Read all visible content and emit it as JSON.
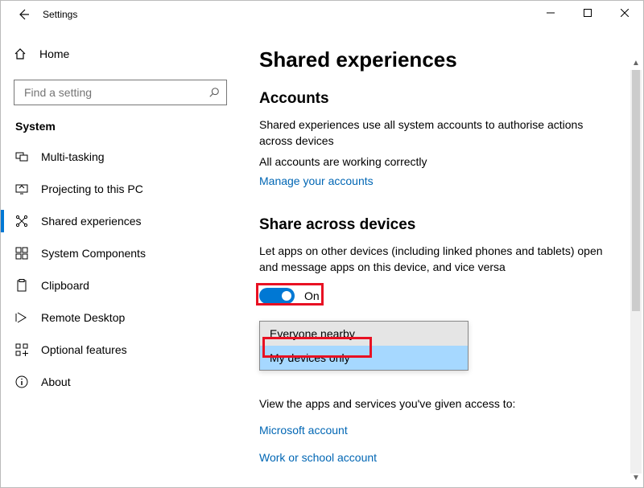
{
  "window": {
    "title": "Settings"
  },
  "search": {
    "placeholder": "Find a setting"
  },
  "home_label": "Home",
  "category": "System",
  "nav": [
    {
      "label": "Multi-tasking"
    },
    {
      "label": "Projecting to this PC"
    },
    {
      "label": "Shared experiences"
    },
    {
      "label": "System Components"
    },
    {
      "label": "Clipboard"
    },
    {
      "label": "Remote Desktop"
    },
    {
      "label": "Optional features"
    },
    {
      "label": "About"
    }
  ],
  "page": {
    "title": "Shared experiences",
    "accounts": {
      "heading": "Accounts",
      "desc": "Shared experiences use all system accounts to authorise actions across devices",
      "status": "All accounts are working correctly",
      "manage_link": "Manage your accounts"
    },
    "share": {
      "heading": "Share across devices",
      "desc": "Let apps on other devices (including linked phones and tablets) open and message apps on this device, and vice versa",
      "toggle_label": "On",
      "options": [
        {
          "label": "Everyone nearby"
        },
        {
          "label": "My devices only"
        }
      ],
      "view_desc": "View the apps and services you've given access to:",
      "ms_link": "Microsoft account",
      "work_link": "Work or school account"
    }
  }
}
